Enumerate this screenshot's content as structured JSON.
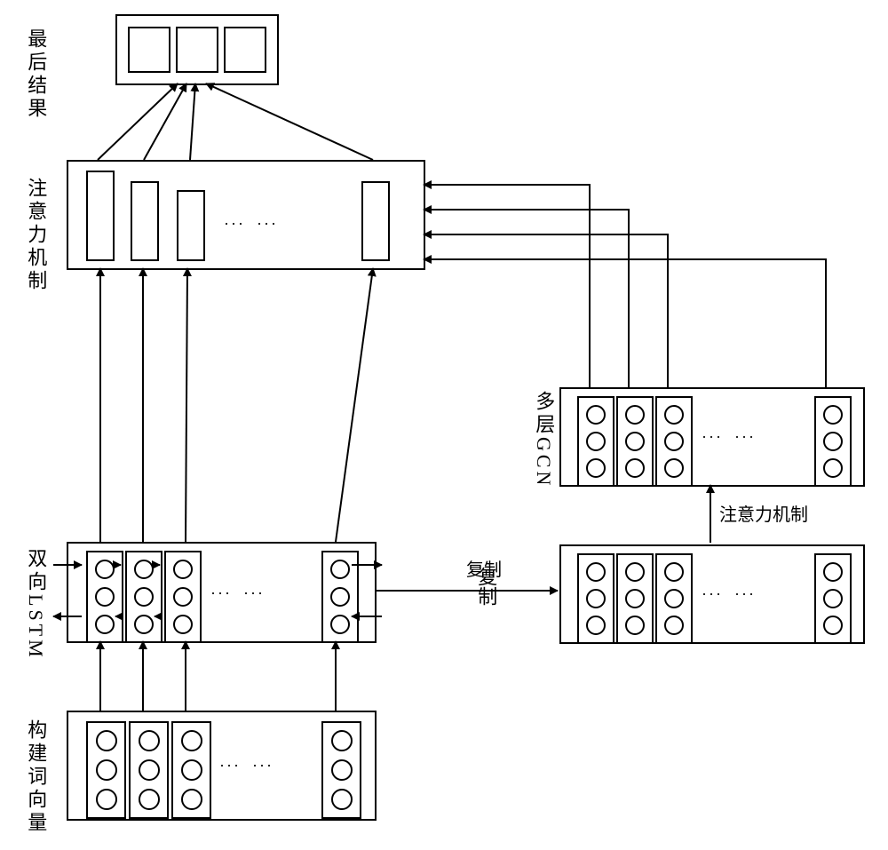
{
  "labels": {
    "final_result": "最后结果",
    "attention": "注意力机制",
    "bilstm": "双向LSTM",
    "word_vectors": "构建词向量",
    "multilayer_gcn": "多层GCN",
    "copy": "复制",
    "attention_small": "注意力机制"
  }
}
